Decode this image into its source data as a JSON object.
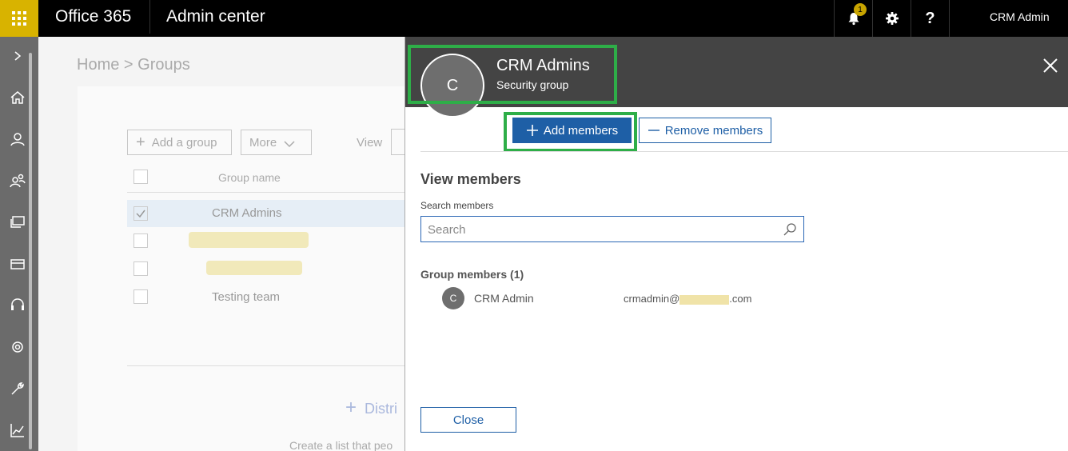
{
  "topbar": {
    "brand": "Office 365",
    "app_name": "Admin center",
    "notification_count": "1",
    "help_label": "?",
    "user_name": "CRM Admin"
  },
  "background": {
    "breadcrumb": "Home > Groups",
    "add_group_label": "Add a group",
    "more_label": "More",
    "view_label": "View",
    "column_group_name": "Group name",
    "rows": [
      {
        "name": "CRM Admins",
        "selected": true
      },
      {
        "name": "",
        "selected": false
      },
      {
        "name": "",
        "selected": false
      },
      {
        "name": "Testing team",
        "selected": false
      }
    ],
    "distribution_label": "Distri",
    "create_text": "Create a list that peo"
  },
  "panel": {
    "avatar_initial": "C",
    "group_title": "CRM Admins",
    "group_type": "Security group",
    "add_members_label": "Add members",
    "remove_members_label": "Remove members",
    "view_members_heading": "View members",
    "search_label": "Search members",
    "search_placeholder": "Search",
    "members_heading": "Group members (1)",
    "members": [
      {
        "initial": "C",
        "name": "CRM Admin",
        "email_prefix": "crmadmin@",
        "email_suffix": ".com"
      }
    ],
    "close_label": "Close"
  },
  "colors": {
    "accent_blue": "#1e5fa6",
    "highlight_green": "#2eae48",
    "waffle_yellow": "#d8b300",
    "panel_header": "#444444"
  }
}
